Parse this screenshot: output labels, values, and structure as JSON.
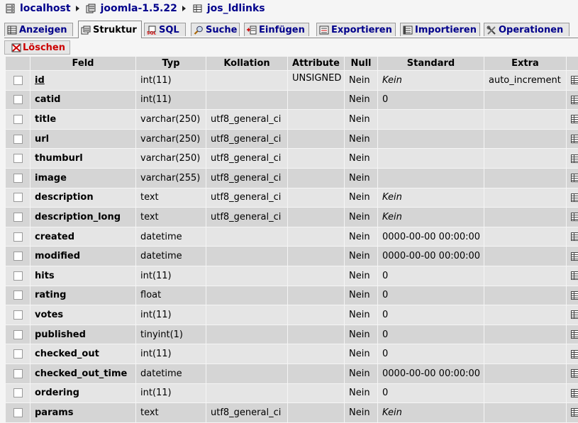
{
  "breadcrumb": [
    {
      "label": "localhost",
      "icon": "server-icon"
    },
    {
      "label": "joomla-1.5.22",
      "icon": "database-icon"
    },
    {
      "label": "jos_ldlinks",
      "icon": "table-icon"
    }
  ],
  "tabs": [
    {
      "label": "Anzeigen",
      "icon": "browse-icon",
      "active": false
    },
    {
      "label": "Struktur",
      "icon": "structure-icon",
      "active": true
    },
    {
      "label": "SQL",
      "icon": "sql-icon",
      "active": false
    },
    {
      "label": "Suche",
      "icon": "search-icon",
      "active": false
    },
    {
      "label": "Einfügen",
      "icon": "insert-icon",
      "active": false
    },
    {
      "label": "Exportieren",
      "icon": "export-icon",
      "active": false
    },
    {
      "label": "Importieren",
      "icon": "import-icon",
      "active": false
    },
    {
      "label": "Operationen",
      "icon": "operations-icon",
      "active": false
    }
  ],
  "drop_label": "Löschen",
  "columns": [
    "Feld",
    "Typ",
    "Kollation",
    "Attribute",
    "Null",
    "Standard",
    "Extra"
  ],
  "rows": [
    {
      "field": "id",
      "type": "int(11)",
      "collation": "",
      "attribute": "UNSIGNED",
      "null": "Nein",
      "default": "Kein",
      "extra": "auto_increment"
    },
    {
      "field": "catid",
      "type": "int(11)",
      "collation": "",
      "attribute": "",
      "null": "Nein",
      "default": "0",
      "extra": ""
    },
    {
      "field": "title",
      "type": "varchar(250)",
      "collation": "utf8_general_ci",
      "attribute": "",
      "null": "Nein",
      "default": "",
      "extra": ""
    },
    {
      "field": "url",
      "type": "varchar(250)",
      "collation": "utf8_general_ci",
      "attribute": "",
      "null": "Nein",
      "default": "",
      "extra": ""
    },
    {
      "field": "thumburl",
      "type": "varchar(250)",
      "collation": "utf8_general_ci",
      "attribute": "",
      "null": "Nein",
      "default": "",
      "extra": ""
    },
    {
      "field": "image",
      "type": "varchar(255)",
      "collation": "utf8_general_ci",
      "attribute": "",
      "null": "Nein",
      "default": "",
      "extra": ""
    },
    {
      "field": "description",
      "type": "text",
      "collation": "utf8_general_ci",
      "attribute": "",
      "null": "Nein",
      "default": "Kein",
      "extra": ""
    },
    {
      "field": "description_long",
      "type": "text",
      "collation": "utf8_general_ci",
      "attribute": "",
      "null": "Nein",
      "default": "Kein",
      "extra": ""
    },
    {
      "field": "created",
      "type": "datetime",
      "collation": "",
      "attribute": "",
      "null": "Nein",
      "default": "0000-00-00 00:00:00",
      "extra": ""
    },
    {
      "field": "modified",
      "type": "datetime",
      "collation": "",
      "attribute": "",
      "null": "Nein",
      "default": "0000-00-00 00:00:00",
      "extra": ""
    },
    {
      "field": "hits",
      "type": "int(11)",
      "collation": "",
      "attribute": "",
      "null": "Nein",
      "default": "0",
      "extra": ""
    },
    {
      "field": "rating",
      "type": "float",
      "collation": "",
      "attribute": "",
      "null": "Nein",
      "default": "0",
      "extra": ""
    },
    {
      "field": "votes",
      "type": "int(11)",
      "collation": "",
      "attribute": "",
      "null": "Nein",
      "default": "0",
      "extra": ""
    },
    {
      "field": "published",
      "type": "tinyint(1)",
      "collation": "",
      "attribute": "",
      "null": "Nein",
      "default": "0",
      "extra": ""
    },
    {
      "field": "checked_out",
      "type": "int(11)",
      "collation": "",
      "attribute": "",
      "null": "Nein",
      "default": "0",
      "extra": ""
    },
    {
      "field": "checked_out_time",
      "type": "datetime",
      "collation": "",
      "attribute": "",
      "null": "Nein",
      "default": "0000-00-00 00:00:00",
      "extra": ""
    },
    {
      "field": "ordering",
      "type": "int(11)",
      "collation": "",
      "attribute": "",
      "null": "Nein",
      "default": "0",
      "extra": ""
    },
    {
      "field": "params",
      "type": "text",
      "collation": "utf8_general_ci",
      "attribute": "",
      "null": "Nein",
      "default": "Kein",
      "extra": ""
    }
  ],
  "colors": {
    "link": "#00008b",
    "drop": "#cc0000",
    "header_bg": "#d3d3d3",
    "row_odd": "#e5e5e5",
    "row_even": "#d5d5d5"
  }
}
